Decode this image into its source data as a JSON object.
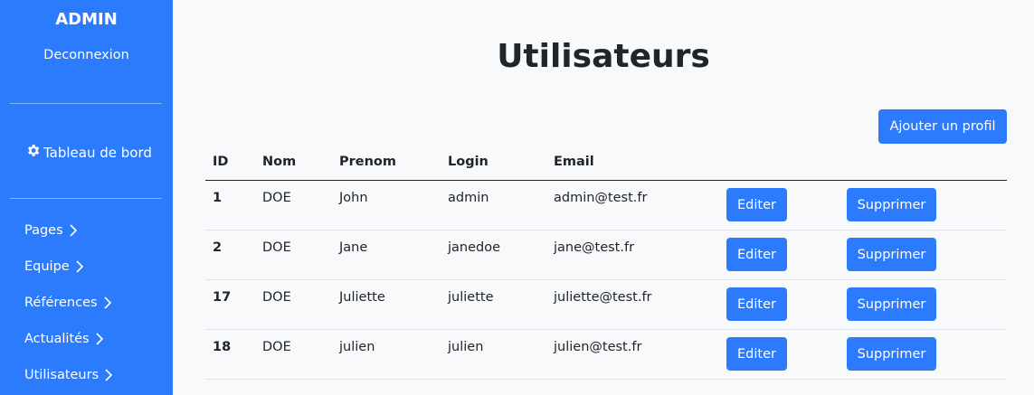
{
  "sidebar": {
    "brand": "ADMIN",
    "logout": "Deconnexion",
    "dashboard": "Tableau de bord",
    "dashboard_icon": "gear-icon",
    "items": [
      {
        "label": "Pages"
      },
      {
        "label": "Equipe"
      },
      {
        "label": "Références"
      },
      {
        "label": "Actualités"
      },
      {
        "label": "Utilisateurs"
      }
    ]
  },
  "main": {
    "title": "Utilisateurs",
    "add_button": "Ajouter un profil",
    "columns": [
      "ID",
      "Nom",
      "Prenom",
      "Login",
      "Email"
    ],
    "edit_label": "Editer",
    "delete_label": "Supprimer",
    "rows": [
      {
        "id": "1",
        "nom": "DOE",
        "prenom": "John",
        "login": "admin",
        "email": "admin@test.fr"
      },
      {
        "id": "2",
        "nom": "DOE",
        "prenom": "Jane",
        "login": "janedoe",
        "email": "jane@test.fr"
      },
      {
        "id": "17",
        "nom": "DOE",
        "prenom": "Juliette",
        "login": "juliette",
        "email": "juliette@test.fr"
      },
      {
        "id": "18",
        "nom": "DOE",
        "prenom": "julien",
        "login": "julien",
        "email": "julien@test.fr"
      }
    ]
  },
  "colors": {
    "accent": "#2c7bfd",
    "background": "#f8f9fb"
  }
}
